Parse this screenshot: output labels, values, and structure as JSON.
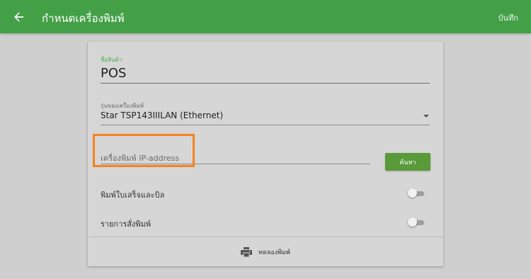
{
  "topbar": {
    "title": "กำหนดเครื่องพิมพ์",
    "save_label": "บันทึก",
    "back_icon": "arrow-left-icon",
    "color": "#43a047"
  },
  "form": {
    "product_name": {
      "label": "ชื่อสินค้า",
      "value": "POS"
    },
    "printer_model": {
      "label": "รุ่นของเครื่องพิมพ์",
      "value": "Star TSP143IIILAN (Ethernet)"
    },
    "ip_address": {
      "placeholder": "เครื่องพิมพ์ IP-address",
      "value": ""
    },
    "search_label": "ค้นหา",
    "toggles": [
      {
        "label": "พิมพ์ใบเสร็จและบิล",
        "on": false
      },
      {
        "label": "รายการสั่งพิมพ์",
        "on": false
      }
    ],
    "test_print_label": "ทดลองพิมพ์",
    "test_print_icon": "printer-icon"
  },
  "colors": {
    "accent_green": "#4caf50",
    "button_green": "#5a9a3a",
    "highlight_orange": "#f58220"
  }
}
